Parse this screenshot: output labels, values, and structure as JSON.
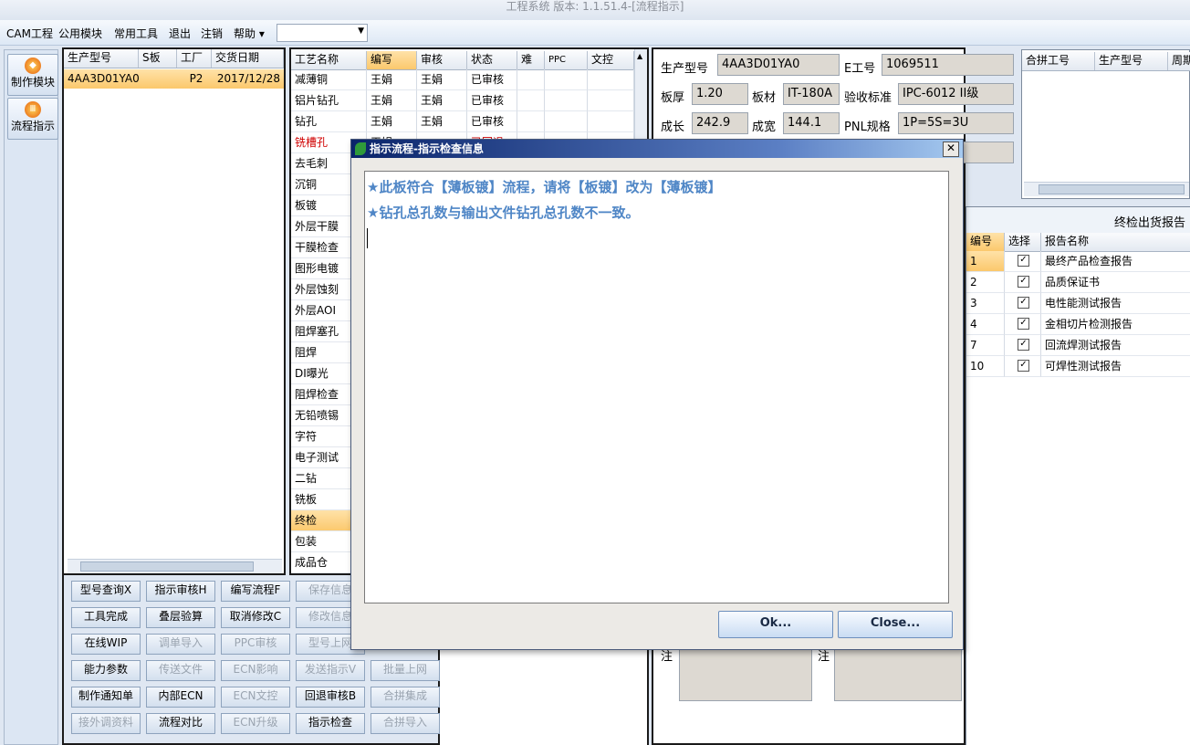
{
  "window": {
    "title": "工程系统 版本: 1.1.51.4-[流程指示]"
  },
  "menu": {
    "items": [
      "CAM工程",
      "公用模块",
      "常用工具",
      "退出",
      "注销",
      "帮助 ▾"
    ],
    "combo_value": ""
  },
  "sidebar": {
    "items": [
      {
        "label": "制作模块"
      },
      {
        "label": "流程指示"
      }
    ]
  },
  "order_grid": {
    "headers": [
      "生产型号",
      "S板",
      "工厂",
      "交货日期"
    ],
    "rows": [
      [
        "4AA3D01YA0",
        "",
        "P2",
        "2017/12/28"
      ]
    ]
  },
  "process_grid": {
    "headers": [
      "工艺名称",
      "编写",
      "审核",
      "状态",
      "难",
      "PPC",
      "文控"
    ],
    "rows": [
      [
        "减薄铜",
        "王娟",
        "王娟",
        "已审核"
      ],
      [
        "铝片钻孔",
        "王娟",
        "王娟",
        "已审核"
      ],
      [
        "钻孔",
        "王娟",
        "王娟",
        "已审核"
      ],
      [
        "铣槽孔",
        "王娟",
        "",
        "已回退"
      ],
      [
        "去毛刺",
        "",
        "",
        ""
      ],
      [
        "沉铜",
        "",
        "",
        ""
      ],
      [
        "板镀",
        "",
        "",
        ""
      ],
      [
        "外层干膜",
        "",
        "",
        ""
      ],
      [
        "干膜检查",
        "",
        "",
        ""
      ],
      [
        "图形电镀",
        "",
        "",
        ""
      ],
      [
        "外层蚀刻",
        "",
        "",
        ""
      ],
      [
        "外层AOI",
        "",
        "",
        ""
      ],
      [
        "阻焊塞孔",
        "",
        "",
        ""
      ],
      [
        "阻焊",
        "",
        "",
        ""
      ],
      [
        "DI曝光",
        "",
        "",
        ""
      ],
      [
        "阻焊检查",
        "",
        "",
        ""
      ],
      [
        "无铅喷锡",
        "",
        "",
        ""
      ],
      [
        "字符",
        "",
        "",
        ""
      ],
      [
        "电子测试",
        "",
        "",
        ""
      ],
      [
        "二钻",
        "",
        "",
        ""
      ],
      [
        "铣板",
        "",
        "",
        ""
      ],
      [
        "终检",
        "",
        "",
        ""
      ],
      [
        "包装",
        "",
        "",
        ""
      ],
      [
        "成品仓",
        "",
        "",
        ""
      ]
    ],
    "selected_row": "终检"
  },
  "buttons": {
    "rows": [
      [
        "型号查询X",
        "指示审核H",
        "编写流程F",
        "保存信息"
      ],
      [
        "工具完成",
        "叠层验算",
        "取消修改C",
        "修改信息"
      ],
      [
        "在线WIP",
        "调单导入",
        "PPC审核",
        "型号上网"
      ],
      [
        "能力参数",
        "传送文件",
        "ECN影响",
        "发送指示V",
        "批量上网"
      ],
      [
        "制作通知单",
        "内部ECN",
        "ECN文控",
        "回退审核B",
        "合拼集成"
      ],
      [
        "接外调资料",
        "流程对比",
        "ECN升级",
        "指示检查",
        "合拼导入"
      ]
    ]
  },
  "info": {
    "model_label": "生产型号",
    "model_value": "4AA3D01YA0",
    "e_label": "E工号",
    "e_value": "1069511",
    "thick_label": "板厚",
    "thick_value": "1.20",
    "material_label": "板材",
    "material_value": "IT-180A",
    "std_label": "验收标准",
    "std_value": "IPC-6012 II级",
    "len_label": "成长",
    "len_value": "242.9",
    "width_label": "成宽",
    "width_value": "144.1",
    "pnl_label": "PNL规格",
    "pnl_value": "1P=5S=3U",
    "note_label": "注"
  },
  "merge_grid": {
    "headers": [
      "合拼工号",
      "生产型号",
      "周期"
    ]
  },
  "report": {
    "title": "终检出货报告",
    "headers": [
      "编号",
      "选择",
      "报告名称"
    ],
    "rows": [
      {
        "id": "1",
        "checked": true,
        "name": "最终产品检查报告"
      },
      {
        "id": "2",
        "checked": true,
        "name": "品质保证书"
      },
      {
        "id": "3",
        "checked": true,
        "name": "电性能测试报告"
      },
      {
        "id": "4",
        "checked": true,
        "name": "金相切片检测报告"
      },
      {
        "id": "7",
        "checked": true,
        "name": "回流焊测试报告"
      },
      {
        "id": "10",
        "checked": true,
        "name": "可焊性测试报告"
      }
    ]
  },
  "dialog": {
    "title": "指示流程-指示检查信息",
    "lines": [
      "★此板符合【薄板镀】流程，请将【板镀】改为【薄板镀】",
      "★钻孔总孔数与输出文件钻孔总孔数不一致。"
    ],
    "ok_label": "Ok...",
    "close_label": "Close..."
  },
  "colors": {
    "accent_row": "#fbc86c",
    "dialog_text": "#4f86c6",
    "returned_status": "#d00000",
    "arrow": "#f5f54a"
  }
}
